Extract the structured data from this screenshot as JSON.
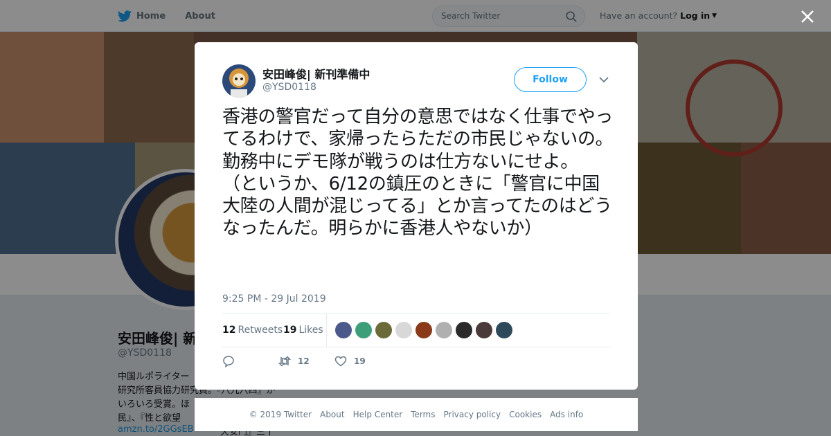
{
  "nav": {
    "home_label": "Home",
    "about_label": "About",
    "search_placeholder": "Search Twitter",
    "account_prompt": "Have an account?",
    "login_label": "Log in"
  },
  "background_profile": {
    "name": "安田峰俊| 新",
    "handle": "@YSD0118",
    "bio_lines": [
      "中国ルポライター",
      "研究所客員協力研究員。『八九六四』が",
      "いろいろ受賞。ほ",
      "民』、『性と欲望"
    ],
    "link": "amzn.to/2GGsEB",
    "bio_tail": "天安門』三十"
  },
  "tweet": {
    "author_name": "安田峰俊| 新刊準備中",
    "author_handle": "@YSD0118",
    "follow_label": "Follow",
    "text": "香港の警官だって自分の意思ではなく仕事でやってるわけで、家帰ったらただの市民じゃないの。勤務中にデモ隊が戦うのは仕方ないにせよ。\n（というか、6/12の鎮圧のときに「警官に中国大陸の人間が混じってる」とか言ってたのはどうなったんだ。明らかに香港人やないか）",
    "timestamp": "9:25 PM - 29 Jul 2019",
    "retweets_count": "12",
    "retweets_label": "Retweets",
    "likes_count": "19",
    "likes_label": "Likes",
    "action_retweet_count": "12",
    "action_like_count": "19"
  },
  "likers": [
    "#4b5a8a",
    "#3d9e7a",
    "#6b6b3a",
    "#d8d8d8",
    "#8a3a1a",
    "#b0b0b0",
    "#2a2a2a",
    "#4a3a3a",
    "#2e4a5a"
  ],
  "footer": {
    "links": [
      "© 2019 Twitter",
      "About",
      "Help Center",
      "Terms",
      "Privacy policy",
      "Cookies",
      "Ads info"
    ]
  },
  "colors": {
    "accent": "#1da1f2",
    "text_secondary": "#657786",
    "overlay": "rgba(0,0,0,0.45)"
  }
}
